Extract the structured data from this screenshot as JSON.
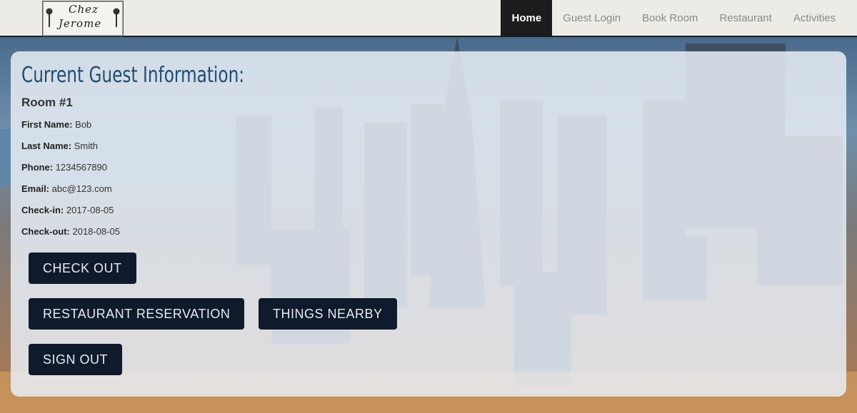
{
  "nav": {
    "logo_line1": "Chez",
    "logo_line2": "Jerome",
    "items": [
      {
        "label": "Home",
        "active": true
      },
      {
        "label": "Guest Login",
        "active": false
      },
      {
        "label": "Book Room",
        "active": false
      },
      {
        "label": "Restaurant",
        "active": false
      },
      {
        "label": "Activities",
        "active": false
      }
    ]
  },
  "guest": {
    "title": "Current Guest Information:",
    "room": "Room #1",
    "fields": [
      {
        "label": "First Name:",
        "value": "Bob"
      },
      {
        "label": "Last Name:",
        "value": "Smith"
      },
      {
        "label": "Phone:",
        "value": "1234567890"
      },
      {
        "label": "Email:",
        "value": "abc@123.com"
      },
      {
        "label": "Check-in:",
        "value": "2017-08-05"
      },
      {
        "label": "Check-out:",
        "value": "2018-08-05"
      }
    ]
  },
  "actions": {
    "check_out": "CHECK OUT",
    "restaurant_reservation": "RESTAURANT RESERVATION",
    "things_nearby": "THINGS NEARBY",
    "sign_out": "SIGN OUT"
  },
  "colors": {
    "title": "#1f4d74",
    "button_bg": "#0f1a2c",
    "nav_active_bg": "#1c1c1c"
  }
}
